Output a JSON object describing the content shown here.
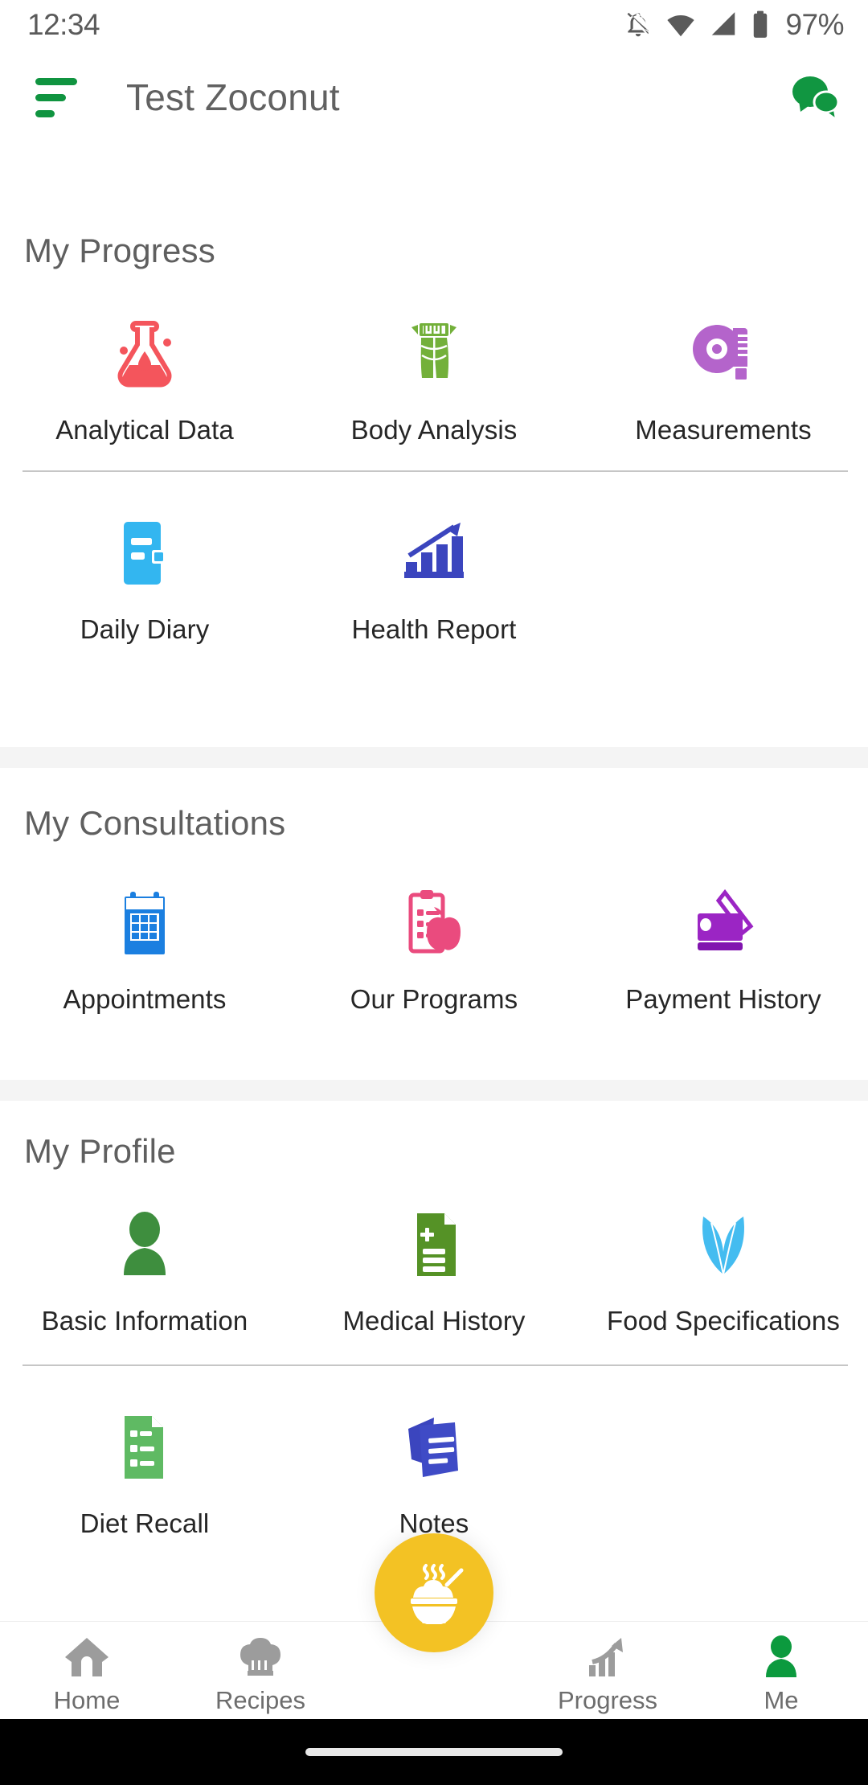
{
  "status_bar": {
    "time": "12:34",
    "battery_percent": "97%",
    "icons": [
      "bell-off-icon",
      "wifi-icon",
      "cellular-signal-icon",
      "battery-icon"
    ]
  },
  "app_bar": {
    "menu_icon": "hamburger-menu-icon",
    "title": "Test Zoconut",
    "action_icon": "chat-bubble-icon",
    "brand_color": "#109440"
  },
  "sections": [
    {
      "title": "My Progress",
      "rows": [
        [
          {
            "label": "Analytical Data",
            "icon": "flask-icon",
            "color": "#F4555C"
          },
          {
            "label": "Body Analysis",
            "icon": "body-measure-icon",
            "color": "#73B03A"
          },
          {
            "label": "Measurements",
            "icon": "measuring-tape-icon",
            "color": "#B464CB"
          }
        ],
        [
          {
            "label": "Daily Diary",
            "icon": "notebook-icon",
            "color": "#33B6F0"
          },
          {
            "label": "Health Report",
            "icon": "bar-chart-arrow-icon",
            "color": "#3B45BE"
          }
        ]
      ]
    },
    {
      "title": "My Consultations",
      "rows": [
        [
          {
            "label": "Appointments",
            "icon": "calendar-icon",
            "color": "#1B7FE0"
          },
          {
            "label": "Our Programs",
            "icon": "clipboard-apple-icon",
            "color": "#EA4B7E"
          },
          {
            "label": "Payment History",
            "icon": "wallet-card-icon",
            "color": "#9B25C4"
          }
        ]
      ]
    },
    {
      "title": "My Profile",
      "rows": [
        [
          {
            "label": "Basic Information",
            "icon": "person-icon",
            "color": "#3E8E3E"
          },
          {
            "label": "Medical History",
            "icon": "medical-document-icon",
            "color": "#559226"
          },
          {
            "label": "Food Specifications",
            "icon": "leaves-icon",
            "color": "#44BCF0"
          }
        ],
        [
          {
            "label": "Diet Recall",
            "icon": "checklist-document-icon",
            "color": "#5FBA63"
          },
          {
            "label": "Notes",
            "icon": "notes-pages-icon",
            "color": "#3B45BE"
          }
        ]
      ]
    }
  ],
  "bottom_nav": {
    "items": [
      {
        "label": "Home",
        "icon": "home-icon",
        "active": false
      },
      {
        "label": "Recipes",
        "icon": "chef-hat-icon",
        "active": false
      },
      {
        "label": "Progress",
        "icon": "progress-chart-icon",
        "active": false
      },
      {
        "label": "Me",
        "icon": "person-icon",
        "active": true
      }
    ],
    "fab": {
      "icon": "rice-bowl-icon",
      "color": "#F3C224"
    },
    "active_color": "#0C9A3E",
    "inactive_color": "#9c9c9c"
  }
}
